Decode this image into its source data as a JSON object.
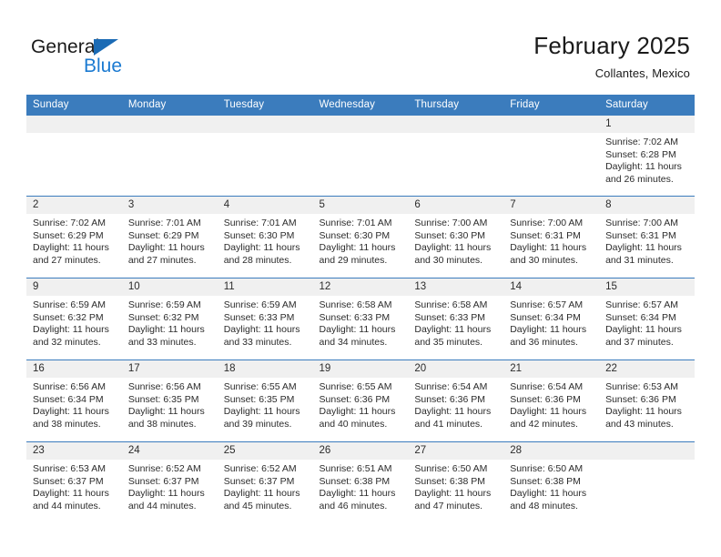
{
  "brand": {
    "name_part1": "General",
    "name_part2": "Blue",
    "triangle_color": "#1b6bb5",
    "blue_color": "#1b7ad1"
  },
  "header": {
    "month_title": "February 2025",
    "location": "Collantes, Mexico"
  },
  "theme": {
    "header_blue": "#3b7cbd",
    "daynum_bg": "#f0f0f0",
    "text": "#2b2b2b"
  },
  "weekday_headers": [
    "Sunday",
    "Monday",
    "Tuesday",
    "Wednesday",
    "Thursday",
    "Friday",
    "Saturday"
  ],
  "labels": {
    "sunrise": "Sunrise:",
    "sunset": "Sunset:",
    "daylight": "Daylight:"
  },
  "weeks": [
    [
      {
        "day": "",
        "blank": true
      },
      {
        "day": "",
        "blank": true
      },
      {
        "day": "",
        "blank": true
      },
      {
        "day": "",
        "blank": true
      },
      {
        "day": "",
        "blank": true
      },
      {
        "day": "",
        "blank": true
      },
      {
        "day": "1",
        "sunrise": "Sunrise: 7:02 AM",
        "sunset": "Sunset: 6:28 PM",
        "daylight": "Daylight: 11 hours and 26 minutes."
      }
    ],
    [
      {
        "day": "2",
        "sunrise": "Sunrise: 7:02 AM",
        "sunset": "Sunset: 6:29 PM",
        "daylight": "Daylight: 11 hours and 27 minutes."
      },
      {
        "day": "3",
        "sunrise": "Sunrise: 7:01 AM",
        "sunset": "Sunset: 6:29 PM",
        "daylight": "Daylight: 11 hours and 27 minutes."
      },
      {
        "day": "4",
        "sunrise": "Sunrise: 7:01 AM",
        "sunset": "Sunset: 6:30 PM",
        "daylight": "Daylight: 11 hours and 28 minutes."
      },
      {
        "day": "5",
        "sunrise": "Sunrise: 7:01 AM",
        "sunset": "Sunset: 6:30 PM",
        "daylight": "Daylight: 11 hours and 29 minutes."
      },
      {
        "day": "6",
        "sunrise": "Sunrise: 7:00 AM",
        "sunset": "Sunset: 6:30 PM",
        "daylight": "Daylight: 11 hours and 30 minutes."
      },
      {
        "day": "7",
        "sunrise": "Sunrise: 7:00 AM",
        "sunset": "Sunset: 6:31 PM",
        "daylight": "Daylight: 11 hours and 30 minutes."
      },
      {
        "day": "8",
        "sunrise": "Sunrise: 7:00 AM",
        "sunset": "Sunset: 6:31 PM",
        "daylight": "Daylight: 11 hours and 31 minutes."
      }
    ],
    [
      {
        "day": "9",
        "sunrise": "Sunrise: 6:59 AM",
        "sunset": "Sunset: 6:32 PM",
        "daylight": "Daylight: 11 hours and 32 minutes."
      },
      {
        "day": "10",
        "sunrise": "Sunrise: 6:59 AM",
        "sunset": "Sunset: 6:32 PM",
        "daylight": "Daylight: 11 hours and 33 minutes."
      },
      {
        "day": "11",
        "sunrise": "Sunrise: 6:59 AM",
        "sunset": "Sunset: 6:33 PM",
        "daylight": "Daylight: 11 hours and 33 minutes."
      },
      {
        "day": "12",
        "sunrise": "Sunrise: 6:58 AM",
        "sunset": "Sunset: 6:33 PM",
        "daylight": "Daylight: 11 hours and 34 minutes."
      },
      {
        "day": "13",
        "sunrise": "Sunrise: 6:58 AM",
        "sunset": "Sunset: 6:33 PM",
        "daylight": "Daylight: 11 hours and 35 minutes."
      },
      {
        "day": "14",
        "sunrise": "Sunrise: 6:57 AM",
        "sunset": "Sunset: 6:34 PM",
        "daylight": "Daylight: 11 hours and 36 minutes."
      },
      {
        "day": "15",
        "sunrise": "Sunrise: 6:57 AM",
        "sunset": "Sunset: 6:34 PM",
        "daylight": "Daylight: 11 hours and 37 minutes."
      }
    ],
    [
      {
        "day": "16",
        "sunrise": "Sunrise: 6:56 AM",
        "sunset": "Sunset: 6:34 PM",
        "daylight": "Daylight: 11 hours and 38 minutes."
      },
      {
        "day": "17",
        "sunrise": "Sunrise: 6:56 AM",
        "sunset": "Sunset: 6:35 PM",
        "daylight": "Daylight: 11 hours and 38 minutes."
      },
      {
        "day": "18",
        "sunrise": "Sunrise: 6:55 AM",
        "sunset": "Sunset: 6:35 PM",
        "daylight": "Daylight: 11 hours and 39 minutes."
      },
      {
        "day": "19",
        "sunrise": "Sunrise: 6:55 AM",
        "sunset": "Sunset: 6:36 PM",
        "daylight": "Daylight: 11 hours and 40 minutes."
      },
      {
        "day": "20",
        "sunrise": "Sunrise: 6:54 AM",
        "sunset": "Sunset: 6:36 PM",
        "daylight": "Daylight: 11 hours and 41 minutes."
      },
      {
        "day": "21",
        "sunrise": "Sunrise: 6:54 AM",
        "sunset": "Sunset: 6:36 PM",
        "daylight": "Daylight: 11 hours and 42 minutes."
      },
      {
        "day": "22",
        "sunrise": "Sunrise: 6:53 AM",
        "sunset": "Sunset: 6:36 PM",
        "daylight": "Daylight: 11 hours and 43 minutes."
      }
    ],
    [
      {
        "day": "23",
        "sunrise": "Sunrise: 6:53 AM",
        "sunset": "Sunset: 6:37 PM",
        "daylight": "Daylight: 11 hours and 44 minutes."
      },
      {
        "day": "24",
        "sunrise": "Sunrise: 6:52 AM",
        "sunset": "Sunset: 6:37 PM",
        "daylight": "Daylight: 11 hours and 44 minutes."
      },
      {
        "day": "25",
        "sunrise": "Sunrise: 6:52 AM",
        "sunset": "Sunset: 6:37 PM",
        "daylight": "Daylight: 11 hours and 45 minutes."
      },
      {
        "day": "26",
        "sunrise": "Sunrise: 6:51 AM",
        "sunset": "Sunset: 6:38 PM",
        "daylight": "Daylight: 11 hours and 46 minutes."
      },
      {
        "day": "27",
        "sunrise": "Sunrise: 6:50 AM",
        "sunset": "Sunset: 6:38 PM",
        "daylight": "Daylight: 11 hours and 47 minutes."
      },
      {
        "day": "28",
        "sunrise": "Sunrise: 6:50 AM",
        "sunset": "Sunset: 6:38 PM",
        "daylight": "Daylight: 11 hours and 48 minutes."
      },
      {
        "day": "",
        "blank": true
      }
    ]
  ]
}
